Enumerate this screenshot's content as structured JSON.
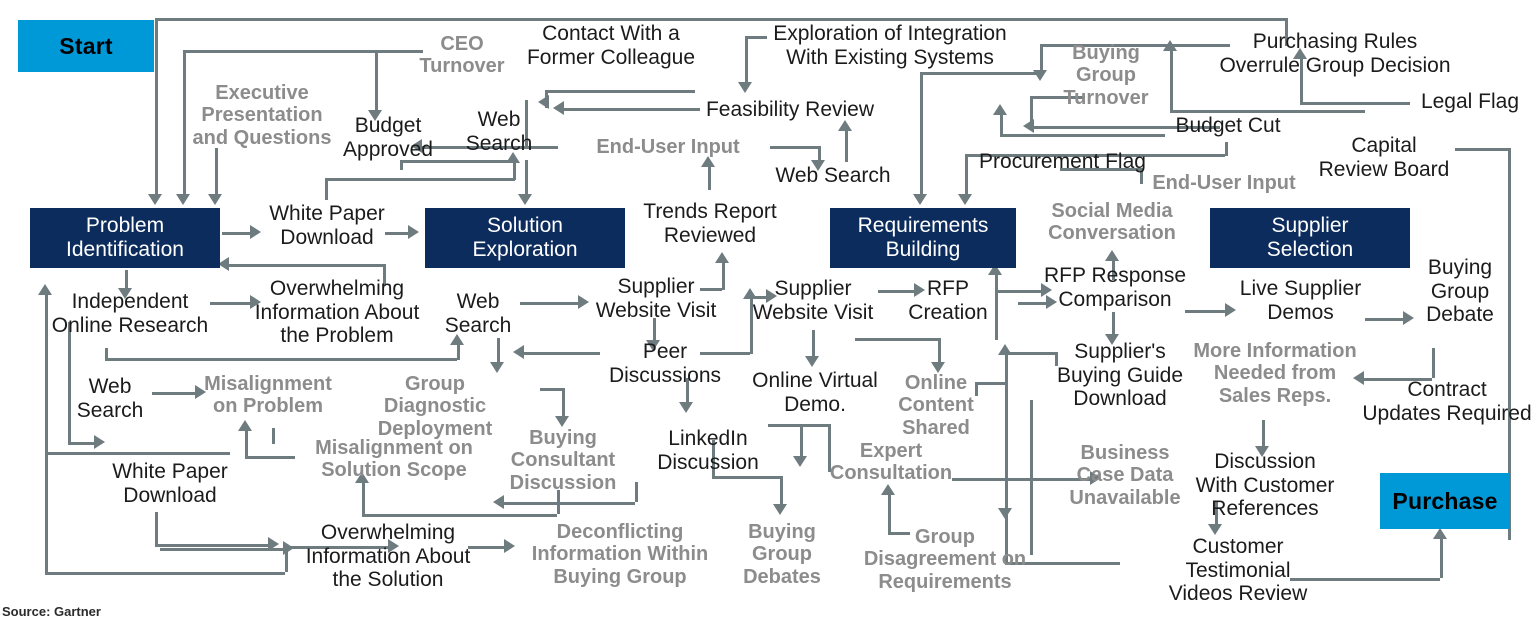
{
  "figure": {
    "source_note": "Source: Gartner",
    "colors": {
      "terminal": "#0099d8",
      "stage_box": "#0d2c5e",
      "activity_text": "#1b1b1b",
      "friction_text": "#8c8c8c",
      "connector": "#6e7b7f"
    }
  },
  "terminals": [
    {
      "id": "start",
      "label": "Start"
    },
    {
      "id": "purchase",
      "label": "Purchase"
    }
  ],
  "stages": [
    {
      "id": "problem-identification",
      "label": "Problem\nIdentification"
    },
    {
      "id": "solution-exploration",
      "label": "Solution\nExploration"
    },
    {
      "id": "requirements-building",
      "label": "Requirements\nBuilding"
    },
    {
      "id": "supplier-selection",
      "label": "Supplier\nSelection"
    }
  ],
  "nodes": [
    {
      "id": "ceo-turnover",
      "label": "CEO\nTurnover",
      "kind": "friction"
    },
    {
      "id": "executive-presentation",
      "label": "Executive\nPresentation\nand Questions",
      "kind": "friction"
    },
    {
      "id": "budget-approved",
      "label": "Budget\nApproved",
      "kind": "activity"
    },
    {
      "id": "contact-former-colleague",
      "label": "Contact With a\nFormer Colleague",
      "kind": "activity"
    },
    {
      "id": "web-search-solution",
      "label": "Web\nSearch",
      "kind": "activity"
    },
    {
      "id": "exploration-integration",
      "label": "Exploration of Integration\nWith Existing Systems",
      "kind": "activity"
    },
    {
      "id": "feasibility-review",
      "label": "Feasibility Review",
      "kind": "activity"
    },
    {
      "id": "end-user-input-left",
      "label": "End-User Input",
      "kind": "friction"
    },
    {
      "id": "web-search-feasibility",
      "label": "Web Search",
      "kind": "activity"
    },
    {
      "id": "buying-group-turnover",
      "label": "Buying\nGroup\nTurnover",
      "kind": "friction"
    },
    {
      "id": "purchasing-rules-overrule",
      "label": "Purchasing Rules\nOverrule Group Decision",
      "kind": "activity"
    },
    {
      "id": "legal-flag",
      "label": "Legal Flag",
      "kind": "activity"
    },
    {
      "id": "budget-cut",
      "label": "Budget Cut",
      "kind": "activity"
    },
    {
      "id": "capital-review-board",
      "label": "Capital\nReview Board",
      "kind": "activity"
    },
    {
      "id": "procurement-flag",
      "label": "Procurement Flag",
      "kind": "activity"
    },
    {
      "id": "end-user-input-right",
      "label": "End-User Input",
      "kind": "friction"
    },
    {
      "id": "white-paper-download-top",
      "label": "White Paper\nDownload",
      "kind": "activity"
    },
    {
      "id": "trends-report-reviewed",
      "label": "Trends Report\nReviewed",
      "kind": "activity"
    },
    {
      "id": "social-media-conversation",
      "label": "Social Media\nConversation",
      "kind": "friction"
    },
    {
      "id": "independent-online-research",
      "label": "Independent\nOnline Research",
      "kind": "activity"
    },
    {
      "id": "overwhelming-info-problem",
      "label": "Overwhelming\nInformation About\nthe Problem",
      "kind": "activity"
    },
    {
      "id": "web-search-mid",
      "label": "Web\nSearch",
      "kind": "activity"
    },
    {
      "id": "supplier-website-visit-left",
      "label": "Supplier\nWebsite Visit",
      "kind": "activity"
    },
    {
      "id": "supplier-website-visit-right",
      "label": "Supplier\nWebsite Visit",
      "kind": "activity"
    },
    {
      "id": "rfp-creation",
      "label": "RFP\nCreation",
      "kind": "activity"
    },
    {
      "id": "rfp-response-comparison",
      "label": "RFP Response\nComparison",
      "kind": "activity"
    },
    {
      "id": "live-supplier-demos",
      "label": "Live Supplier\nDemos",
      "kind": "activity"
    },
    {
      "id": "buying-group-debate",
      "label": "Buying\nGroup\nDebate",
      "kind": "activity"
    },
    {
      "id": "peer-discussions",
      "label": "Peer\nDiscussions",
      "kind": "activity"
    },
    {
      "id": "online-virtual-demo",
      "label": "Online Virtual\nDemo.",
      "kind": "activity"
    },
    {
      "id": "online-content-shared",
      "label": "Online\nContent\nShared",
      "kind": "friction"
    },
    {
      "id": "suppliers-buying-guide",
      "label": "Supplier's\nBuying Guide\nDownload",
      "kind": "activity"
    },
    {
      "id": "more-information-needed",
      "label": "More Information\nNeeded from\nSales Reps.",
      "kind": "friction"
    },
    {
      "id": "contract-updates-required",
      "label": "Contract\nUpdates Required",
      "kind": "activity"
    },
    {
      "id": "web-search-bottom",
      "label": "Web\nSearch",
      "kind": "activity"
    },
    {
      "id": "misalignment-problem",
      "label": "Misalignment\non Problem",
      "kind": "friction"
    },
    {
      "id": "group-diagnostic-deployment",
      "label": "Group Diagnostic\nDeployment",
      "kind": "friction"
    },
    {
      "id": "misalignment-solution-scope",
      "label": "Misalignment on\nSolution Scope",
      "kind": "friction"
    },
    {
      "id": "buying-consultant-discussion",
      "label": "Buying\nConsultant\nDiscussion",
      "kind": "friction"
    },
    {
      "id": "linkedin-discussion",
      "label": "LinkedIn\nDiscussion",
      "kind": "activity"
    },
    {
      "id": "expert-consultation",
      "label": "Expert\nConsultation",
      "kind": "friction"
    },
    {
      "id": "business-case-data",
      "label": "Business\nCase Data\nUnavailable",
      "kind": "friction"
    },
    {
      "id": "discussion-customer-refs",
      "label": "Discussion\nWith Customer\nReferences",
      "kind": "activity"
    },
    {
      "id": "white-paper-download-bottom",
      "label": "White Paper\nDownload",
      "kind": "activity"
    },
    {
      "id": "overwhelming-info-solution",
      "label": "Overwhelming\nInformation About\nthe Solution",
      "kind": "activity"
    },
    {
      "id": "deconflicting-information",
      "label": "Deconflicting\nInformation Within\nBuying Group",
      "kind": "friction"
    },
    {
      "id": "buying-group-debates",
      "label": "Buying\nGroup\nDebates",
      "kind": "friction"
    },
    {
      "id": "group-disagreement",
      "label": "Group\nDisagreement on\nRequirements",
      "kind": "friction"
    },
    {
      "id": "customer-testimonial-videos",
      "label": "Customer\nTestimonial\nVideos Review",
      "kind": "activity"
    }
  ]
}
